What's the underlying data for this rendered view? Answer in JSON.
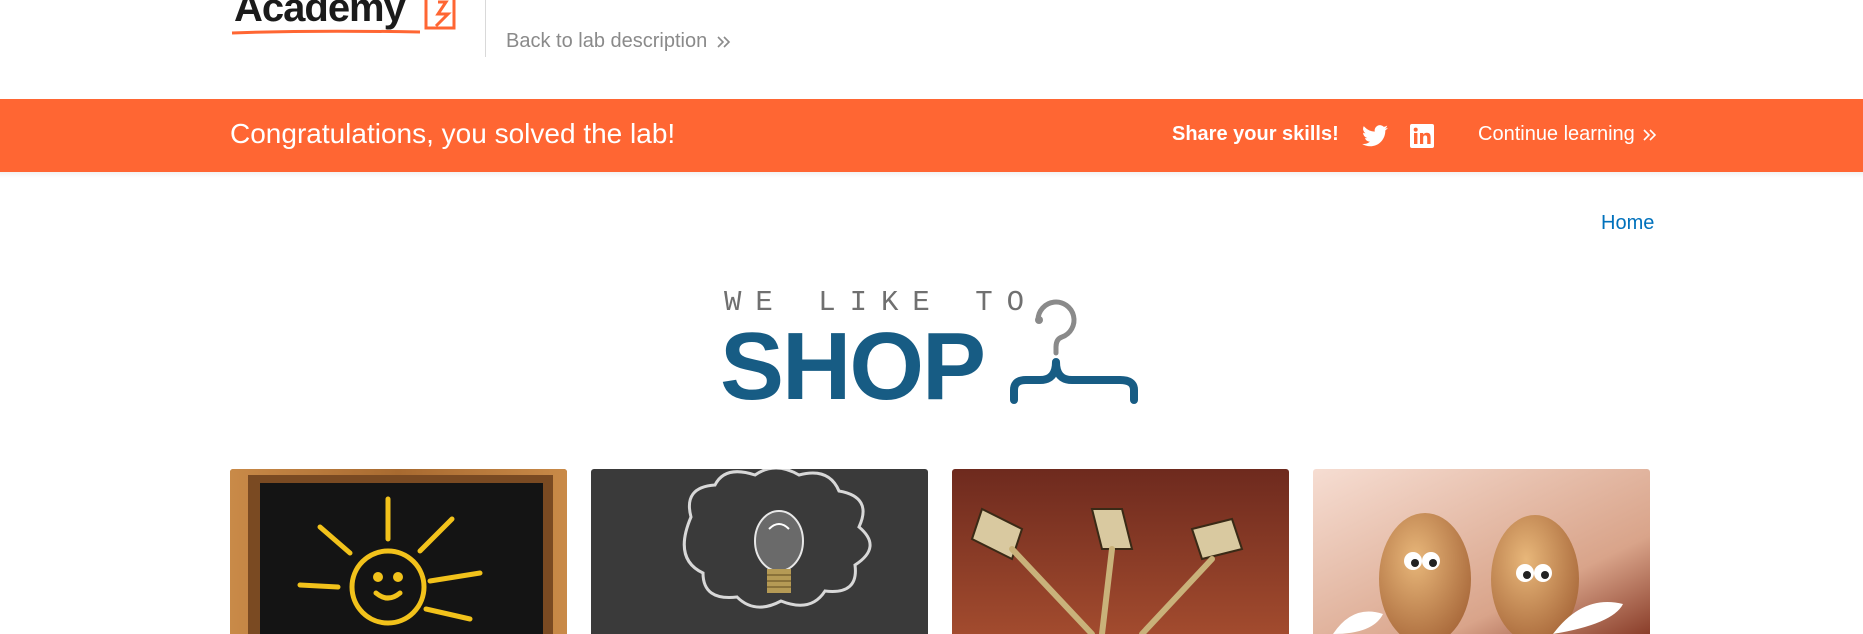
{
  "header": {
    "logo_text": "Academy",
    "back_link": "Back to lab description"
  },
  "banner": {
    "title": "Congratulations, you solved the lab!",
    "share_label": "Share your skills!",
    "social_icons": [
      "twitter-icon",
      "linkedin-icon"
    ],
    "continue_label": "Continue learning",
    "color": "#ff6633"
  },
  "nav": {
    "home_label": "Home"
  },
  "shop_logo": {
    "top_line": "WE LIKE TO",
    "main_word": "SHOP",
    "color": "#175c84"
  },
  "products": [
    {
      "image": "chalkboard-sun-image"
    },
    {
      "image": "lightbulb-cloud-image"
    },
    {
      "image": "darts-image"
    },
    {
      "image": "eggs-image"
    }
  ]
}
